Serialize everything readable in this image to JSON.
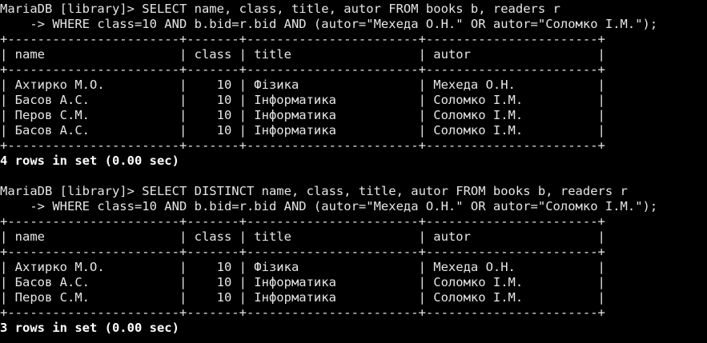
{
  "terminal": {
    "lines": [
      "MariaDB [library]> SELECT name, class, title, autor FROM books b, readers r",
      "    -> WHERE class=10 AND b.bid=r.bid AND (autor=\"Мехеда О.Н.\" OR autor=\"Соломко І.М.\");",
      "+-----------------------+-------+-----------------------+-----------------------+",
      "| name                  | class | title                 | autor                 |",
      "+-----------------------+-------+-----------------------+-----------------------+",
      "| Ахтирко М.О.          |    10 | Фізика                | Мехеда О.Н.           |",
      "| Басов А.С.            |    10 | Інформатика           | Соломко І.М.          |",
      "| Перов С.М.            |    10 | Інформатика           | Соломко І.М.          |",
      "| Басов А.С.            |    10 | Інформатика           | Соломко І.М.          |",
      "+-----------------------+-------+-----------------------+-----------------------+",
      "4 rows in set (0.00 sec)",
      "",
      "MariaDB [library]> SELECT DISTINCT name, class, title, autor FROM books b, readers r",
      "    -> WHERE class=10 AND b.bid=r.bid AND (autor=\"Мехеда О.Н.\" OR autor=\"Соломко І.М.\");",
      "+-----------------------+-------+-----------------------+-----------------------+",
      "| name                  | class | title                 | autor                 |",
      "+-----------------------+-------+-----------------------+-----------------------+",
      "| Ахтирко М.О.          |    10 | Фізика                | Мехеда О.Н.           |",
      "| Басов А.С.            |    10 | Інформатика           | Соломко І.М.          |",
      "| Перов С.М.            |    10 | Інформатика           | Соломко І.М.          |",
      "+-----------------------+-------+-----------------------+-----------------------+",
      "3 rows in set (0.00 sec)"
    ],
    "colors": {
      "background": "#000000",
      "text": "#e6e6e6"
    }
  }
}
